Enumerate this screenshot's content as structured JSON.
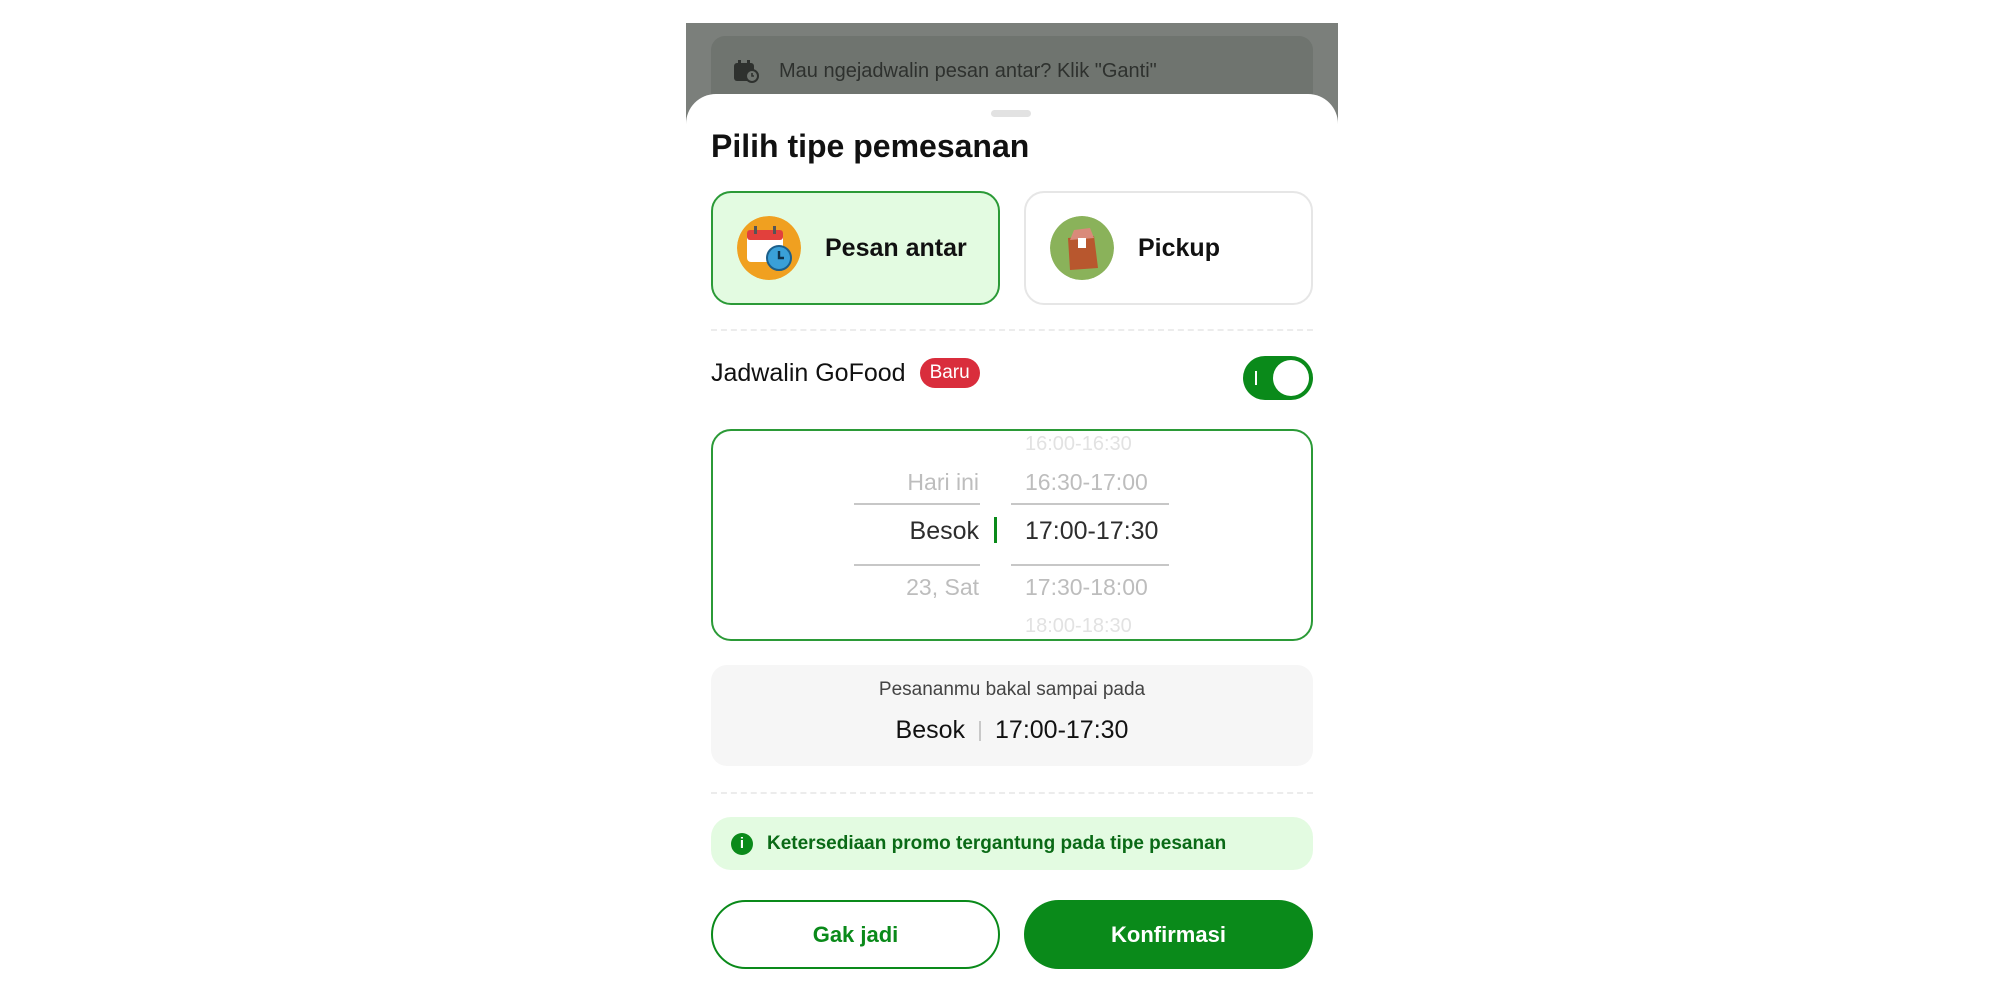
{
  "background": {
    "banner_text": "Mau ngejadwalin pesan antar? Klik \"Ganti\"",
    "banner_icon": "calendar-clock-icon"
  },
  "sheet": {
    "title": "Pilih tipe pemesanan",
    "options": [
      {
        "label": "Pesan antar",
        "icon": "scheduled-delivery-icon",
        "selected": true
      },
      {
        "label": "Pickup",
        "icon": "shopping-bag-icon",
        "selected": false
      }
    ],
    "schedule": {
      "label": "Jadwalin GoFood",
      "badge": "Baru",
      "toggle_on": true
    },
    "picker": {
      "days": {
        "prev": "Hari ini",
        "selected": "Besok",
        "next": "23, Sat"
      },
      "times": {
        "prev": "16:30-17:00",
        "selected": "17:00-17:30",
        "next": "17:30-18:00"
      }
    },
    "eta": {
      "caption": "Pesananmu bakal sampai pada",
      "day": "Besok",
      "time": "17:00-17:30"
    },
    "promo_note": "Ketersediaan promo tergantung pada tipe pesanan",
    "buttons": {
      "cancel": "Gak jadi",
      "confirm": "Konfirmasi"
    }
  },
  "colors": {
    "primary": "#0a8a1a",
    "selected_bg": "#e3fbe1",
    "badge": "#d92d3c"
  }
}
